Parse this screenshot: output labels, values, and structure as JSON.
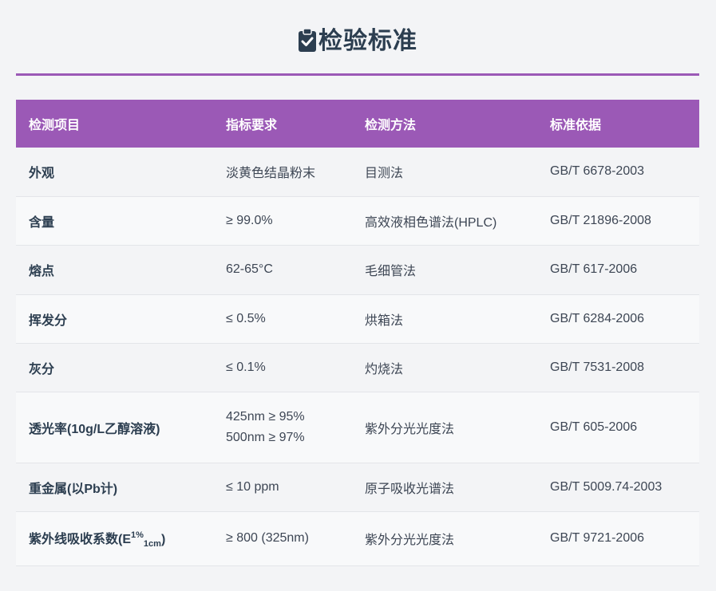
{
  "title": "检验标准",
  "colors": {
    "accent": "#9b59b6",
    "title": "#2c3e50"
  },
  "icon": "clipboard-check-icon",
  "headers": [
    "检测项目",
    "指标要求",
    "检测方法",
    "标准依据"
  ],
  "rows": [
    {
      "item": "外观",
      "requirement": "淡黄色结晶粉末",
      "method": "目测法",
      "standard": "GB/T 6678-2003"
    },
    {
      "item": "含量",
      "requirement": "≥ 99.0%",
      "method": "高效液相色谱法(HPLC)",
      "standard": "GB/T 21896-2008"
    },
    {
      "item": "熔点",
      "requirement": "62-65°C",
      "method": "毛细管法",
      "standard": "GB/T 617-2006"
    },
    {
      "item": "挥发分",
      "requirement": "≤ 0.5%",
      "method": "烘箱法",
      "standard": "GB/T 6284-2006"
    },
    {
      "item": "灰分",
      "requirement": "≤ 0.1%",
      "method": "灼烧法",
      "standard": "GB/T 7531-2008"
    },
    {
      "item": "透光率(10g/L乙醇溶液)",
      "requirement_lines": [
        "425nm ≥ 95%",
        "500nm ≥ 97%"
      ],
      "method": "紫外分光光度法",
      "standard": "GB/T 605-2006"
    },
    {
      "item": "重金属(以Pb计)",
      "requirement": "≤ 10 ppm",
      "method": "原子吸收光谱法",
      "standard": "GB/T 5009.74-2003"
    },
    {
      "item_parts": {
        "main": "紫外线吸收系数(E",
        "sup": "1%",
        "sub": "1cm",
        "close": ")"
      },
      "requirement": "≥ 800 (325nm)",
      "method": "紫外分光光度法",
      "standard": "GB/T 9721-2006"
    }
  ]
}
